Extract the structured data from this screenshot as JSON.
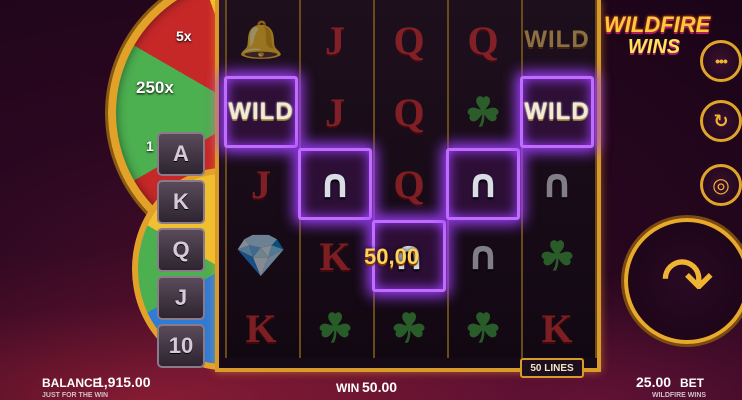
{
  "game": {
    "logo_line1": "WILDFIRE",
    "logo_line2": "WINS"
  },
  "wheel": {
    "labels": [
      "5x",
      "250x",
      "1"
    ]
  },
  "card_strip": [
    "A",
    "K",
    "Q",
    "J",
    "10"
  ],
  "reels": [
    [
      {
        "sym": "bell",
        "label": "🔔",
        "win": false
      },
      {
        "sym": "wild",
        "label": "WILD",
        "win": true
      },
      {
        "sym": "letter",
        "label": "J",
        "win": false
      },
      {
        "sym": "diamond",
        "label": "💎",
        "win": false
      },
      {
        "sym": "letter",
        "label": "K",
        "win": false
      }
    ],
    [
      {
        "sym": "letter",
        "label": "J",
        "win": false
      },
      {
        "sym": "letter",
        "label": "J",
        "win": false
      },
      {
        "sym": "shoe",
        "label": "∩",
        "win": true
      },
      {
        "sym": "letter",
        "label": "K",
        "win": false
      },
      {
        "sym": "clover",
        "label": "☘",
        "win": false
      }
    ],
    [
      {
        "sym": "letter",
        "label": "Q",
        "win": false
      },
      {
        "sym": "letter",
        "label": "Q",
        "win": false
      },
      {
        "sym": "letter",
        "label": "Q",
        "win": false
      },
      {
        "sym": "shoe",
        "label": "∩",
        "win": true
      },
      {
        "sym": "clover",
        "label": "☘",
        "win": false
      }
    ],
    [
      {
        "sym": "letter",
        "label": "Q",
        "win": false
      },
      {
        "sym": "clover",
        "label": "☘",
        "win": false
      },
      {
        "sym": "shoe",
        "label": "∩",
        "win": true
      },
      {
        "sym": "shoe",
        "label": "∩",
        "win": false
      },
      {
        "sym": "clover",
        "label": "☘",
        "win": false
      }
    ],
    [
      {
        "sym": "wildgold",
        "label": "WILD",
        "win": false
      },
      {
        "sym": "wild",
        "label": "WILD",
        "win": true
      },
      {
        "sym": "shoe",
        "label": "∩",
        "win": false
      },
      {
        "sym": "clover",
        "label": "☘",
        "win": false
      },
      {
        "sym": "letter",
        "label": "K",
        "win": false
      }
    ]
  ],
  "win_amount_display": "50,00",
  "lines_badge": "50 LINES",
  "buttons": {
    "menu_icon": "•••",
    "autoplay_icon": "↻",
    "chip_icon": "◎",
    "spin_icon": "↷"
  },
  "footer": {
    "balance_label": "BALANCE",
    "balance_value": "1,915.00",
    "tagline": "JUST FOR THE WIN",
    "win_label": "WIN",
    "win_value": "50.00",
    "bet_value": "25.00",
    "bet_label": "BET",
    "game_name": "WILDFIRE WINS"
  }
}
